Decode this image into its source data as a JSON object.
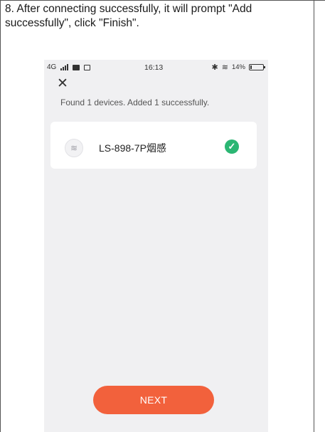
{
  "document": {
    "instruction": "8. After connecting successfully, it will prompt \"Add successfully\", click \"Finish\"."
  },
  "status_bar": {
    "network": "4G",
    "time": "16:13",
    "battery_text": "14%",
    "battery_level": 0.14
  },
  "screen": {
    "close_icon": "close-icon",
    "found_text": "Found 1 devices. Added 1 successfully.",
    "device": {
      "name": "LS-898-7P烟感",
      "icon": "smoke-detector-icon",
      "status_icon": "check-icon",
      "status_color": "#2bb673"
    },
    "next_button": "NEXT",
    "accent_color": "#f2613c"
  }
}
